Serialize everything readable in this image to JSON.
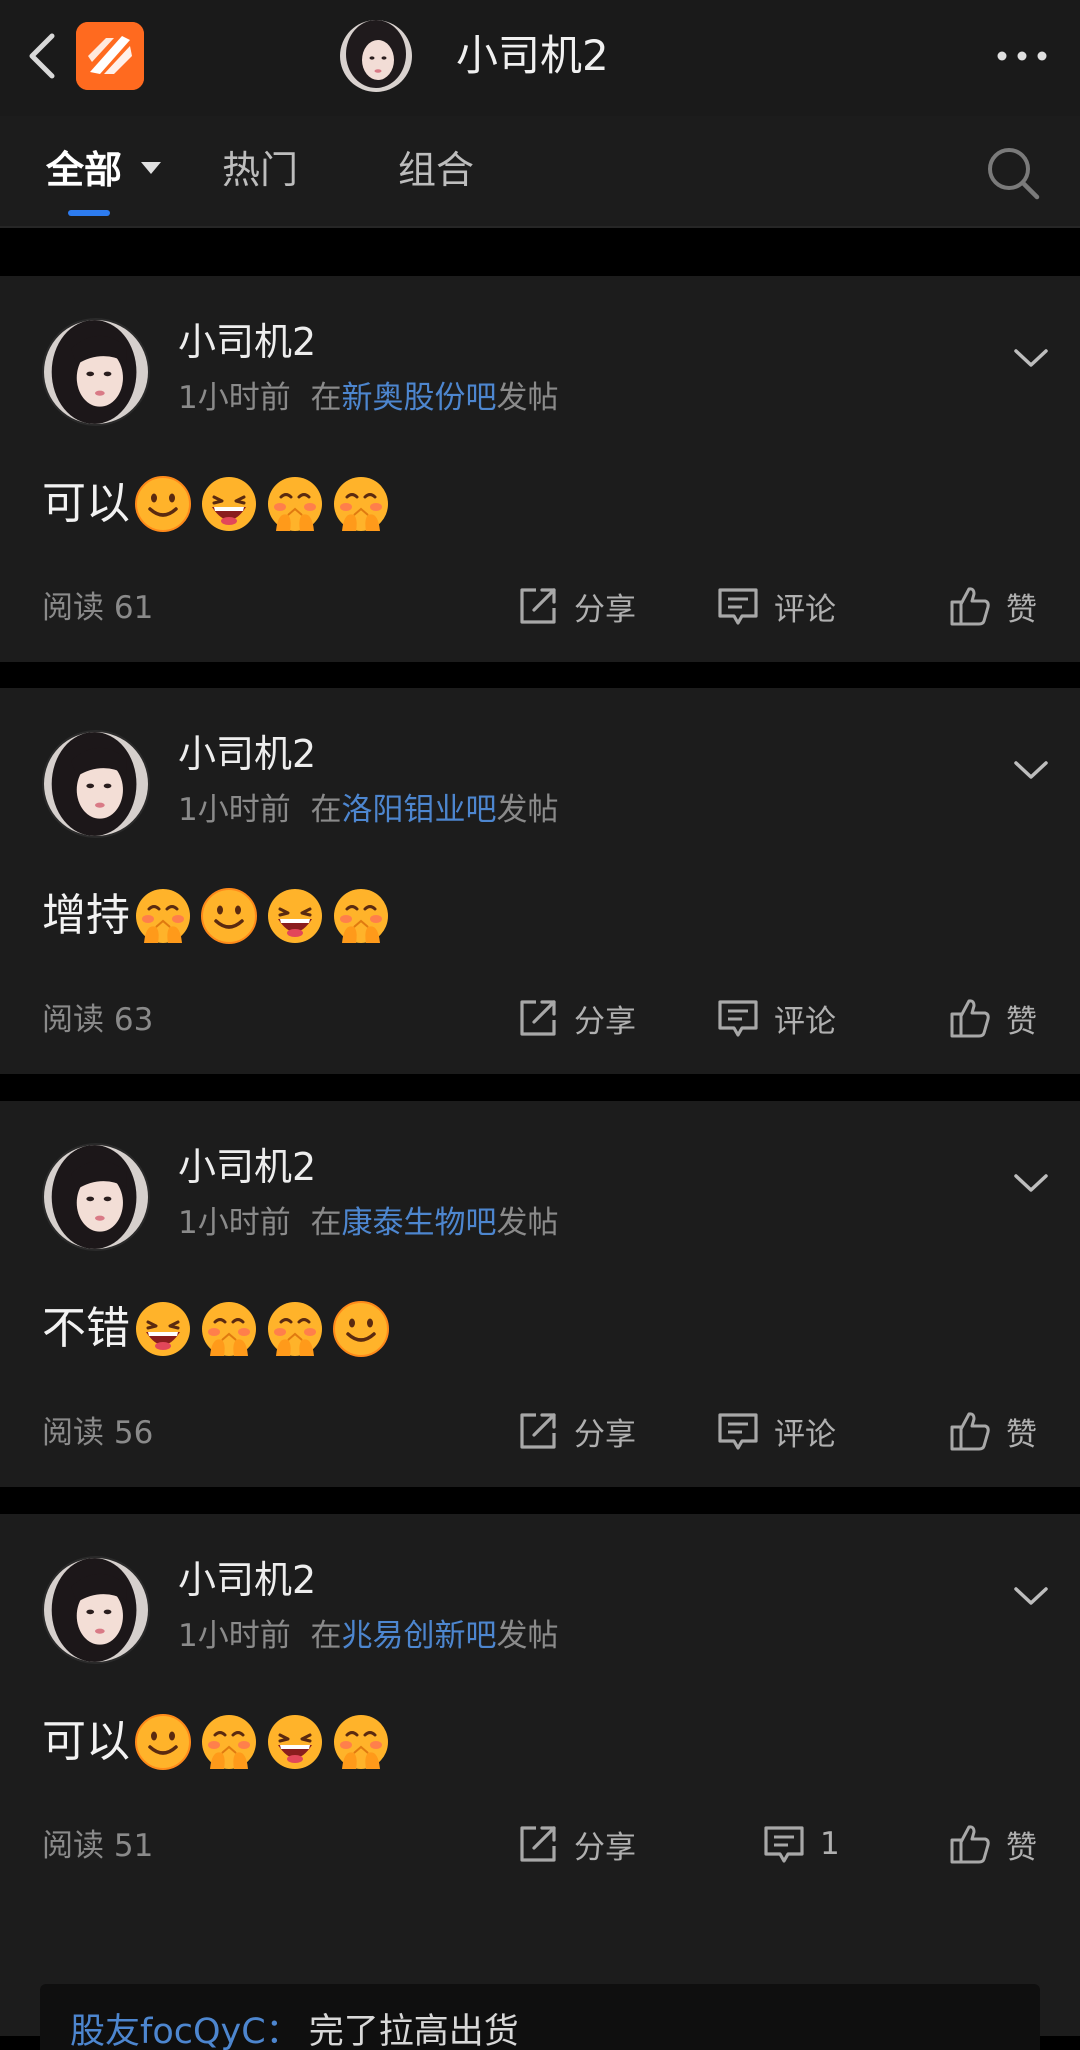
{
  "header": {
    "title": "小司机2"
  },
  "tabs": [
    {
      "label": "全部",
      "active": true
    },
    {
      "label": "热门",
      "active": false
    },
    {
      "label": "组合",
      "active": false
    }
  ],
  "posts": [
    {
      "author": "小司机2",
      "time": "1小时前",
      "prefix": "在",
      "board": "新奥股份吧",
      "suffix": "发帖",
      "text": "可以",
      "emojis": [
        "smile-emoji",
        "laugh-emoji",
        "blush-hands-emoji",
        "blush-hands-emoji"
      ],
      "reads": "阅读 61",
      "share": "分享",
      "comment": "评论",
      "like": "赞"
    },
    {
      "author": "小司机2",
      "time": "1小时前",
      "prefix": "在",
      "board": "洛阳钼业吧",
      "suffix": "发帖",
      "text": "增持",
      "emojis": [
        "blush-hands-emoji",
        "smile-emoji",
        "laugh-emoji",
        "blush-hands-emoji"
      ],
      "reads": "阅读 63",
      "share": "分享",
      "comment": "评论",
      "like": "赞"
    },
    {
      "author": "小司机2",
      "time": "1小时前",
      "prefix": "在",
      "board": "康泰生物吧",
      "suffix": "发帖",
      "text": "不错",
      "emojis": [
        "laugh-emoji",
        "blush-hands-emoji",
        "blush-hands-emoji",
        "smile-emoji"
      ],
      "reads": "阅读 56",
      "share": "分享",
      "comment": "评论",
      "like": "赞"
    },
    {
      "author": "小司机2",
      "time": "1小时前",
      "prefix": "在",
      "board": "兆易创新吧",
      "suffix": "发帖",
      "text": "可以",
      "emojis": [
        "smile-emoji",
        "blush-hands-emoji",
        "laugh-emoji",
        "blush-hands-emoji"
      ],
      "reads": "阅读 51",
      "share": "分享",
      "comment": "1",
      "like": "赞",
      "reply": {
        "user": "股友focQyC：",
        "text": "完了拉高出货"
      }
    }
  ],
  "colors": {
    "background": "#000000",
    "card": "#1c1c1c",
    "accent_blue": "#4d86cf",
    "tab_underline": "#2d7cf0",
    "logo_orange": "#ff6a1f"
  }
}
